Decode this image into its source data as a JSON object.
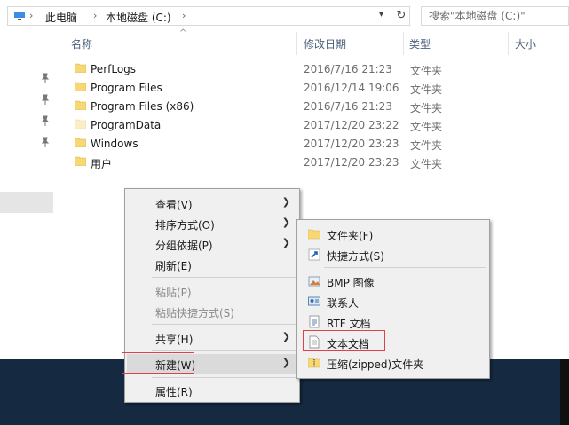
{
  "address": {
    "crumbs": [
      "此电脑",
      "本地磁盘 (C:)"
    ],
    "search_placeholder": "搜索\"本地磁盘 (C:)\""
  },
  "columns": {
    "name": "名称",
    "modified": "修改日期",
    "type": "类型",
    "size": "大小"
  },
  "files": [
    {
      "name": "PerfLogs",
      "modified": "2016/7/16 21:23",
      "type": "文件夹"
    },
    {
      "name": "Program Files",
      "modified": "2016/12/14 19:06",
      "type": "文件夹"
    },
    {
      "name": "Program Files (x86)",
      "modified": "2016/7/16 21:23",
      "type": "文件夹"
    },
    {
      "name": "ProgramData",
      "modified": "2017/12/20 23:22",
      "type": "文件夹"
    },
    {
      "name": "Windows",
      "modified": "2017/12/20 23:23",
      "type": "文件夹"
    },
    {
      "name": "用户",
      "modified": "2017/12/20 23:23",
      "type": "文件夹"
    }
  ],
  "context_menu": {
    "view": "查看(V)",
    "sort": "排序方式(O)",
    "group": "分组依据(P)",
    "refresh": "刷新(E)",
    "paste": "粘贴(P)",
    "paste_shortcut": "粘贴快捷方式(S)",
    "share": "共享(H)",
    "new": "新建(W)",
    "properties": "属性(R)"
  },
  "new_submenu": {
    "folder": "文件夹(F)",
    "shortcut": "快捷方式(S)",
    "bmp": "BMP 图像",
    "contact": "联系人",
    "rtf": "RTF 文档",
    "text": "文本文档",
    "zip": "压缩(zipped)文件夹"
  },
  "colors": {
    "folder": "#f8d775",
    "highlight": "#e0404a",
    "taskbar": "#152a40"
  }
}
